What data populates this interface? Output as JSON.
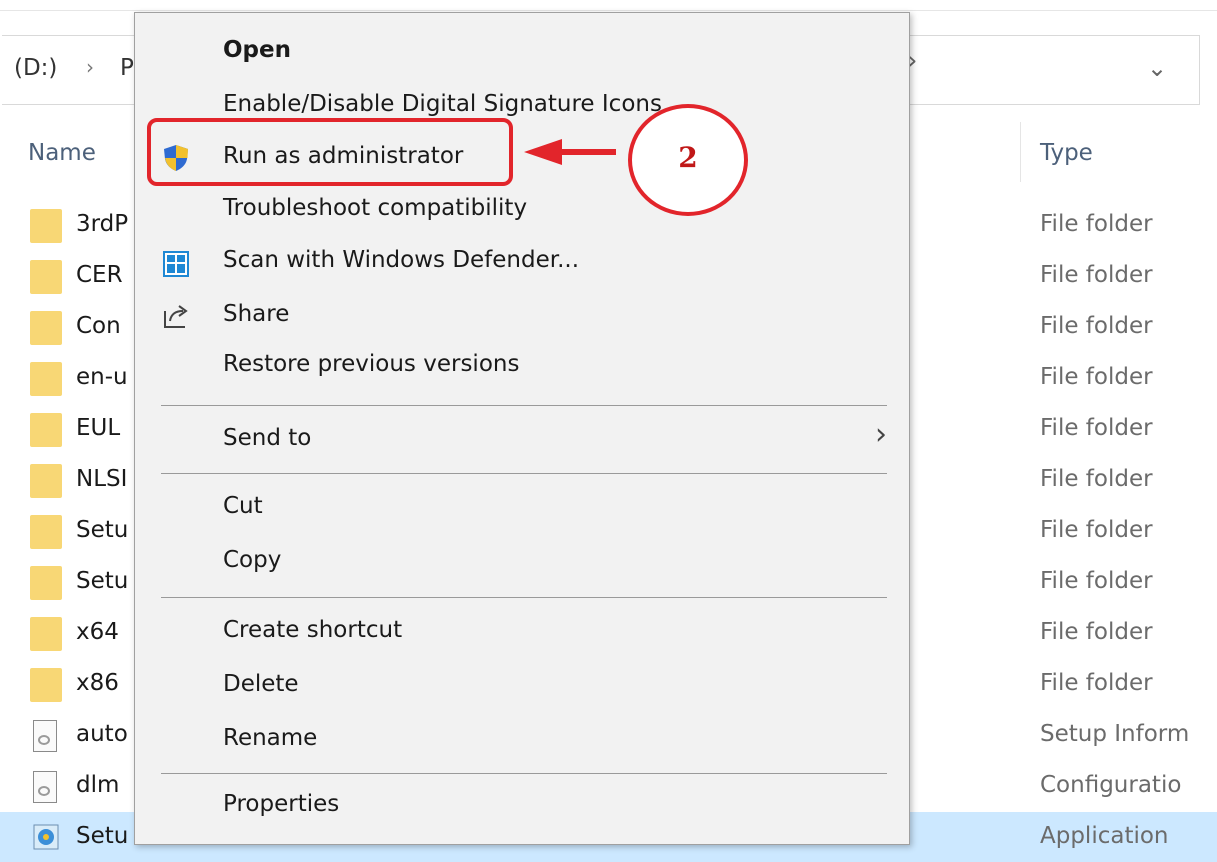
{
  "address": {
    "drive": "(D:)",
    "separator": "›",
    "path_fragment": "P",
    "dropdown_icon": "chevron-down-icon",
    "forward_icon": "chevron-right-icon"
  },
  "columns": {
    "name": "Name",
    "type": "Type"
  },
  "rows": [
    {
      "name": "3rdP",
      "type": "File folder",
      "icon": "folder-icon"
    },
    {
      "name": "CER",
      "type": "File folder",
      "icon": "folder-icon"
    },
    {
      "name": "Con",
      "type": "File folder",
      "icon": "folder-icon"
    },
    {
      "name": "en-u",
      "type": "File folder",
      "icon": "folder-icon"
    },
    {
      "name": "EUL",
      "type": "File folder",
      "icon": "folder-icon"
    },
    {
      "name": "NLSI",
      "type": "File folder",
      "icon": "folder-icon"
    },
    {
      "name": "Setu",
      "type": "File folder",
      "icon": "folder-icon"
    },
    {
      "name": "Setu",
      "type": "File folder",
      "icon": "folder-icon"
    },
    {
      "name": "x64",
      "type": "File folder",
      "icon": "folder-icon"
    },
    {
      "name": "x86",
      "type": "File folder",
      "icon": "folder-icon"
    },
    {
      "name": "auto",
      "type": "Setup Inform",
      "icon": "settings-file-icon"
    },
    {
      "name": "dlm",
      "type": "Configuratio",
      "icon": "settings-file-icon"
    },
    {
      "name": "Setu",
      "type": "Application",
      "icon": "setup-app-icon",
      "selected": true
    }
  ],
  "context_menu": {
    "open": "Open",
    "digital_signature": "Enable/Disable Digital Signature Icons",
    "run_as_admin": "Run as administrator",
    "troubleshoot": "Troubleshoot compatibility",
    "scan_defender": "Scan with Windows Defender...",
    "share": "Share",
    "restore_versions": "Restore previous versions",
    "send_to": "Send to",
    "cut": "Cut",
    "copy": "Copy",
    "create_shortcut": "Create shortcut",
    "delete": "Delete",
    "rename": "Rename",
    "properties": "Properties"
  },
  "annotation": {
    "step_number": "2",
    "color": "#e2252b"
  },
  "colors": {
    "selection": "#cce8ff",
    "menu_bg": "#f2f2f2",
    "folder": "#f8d775"
  }
}
